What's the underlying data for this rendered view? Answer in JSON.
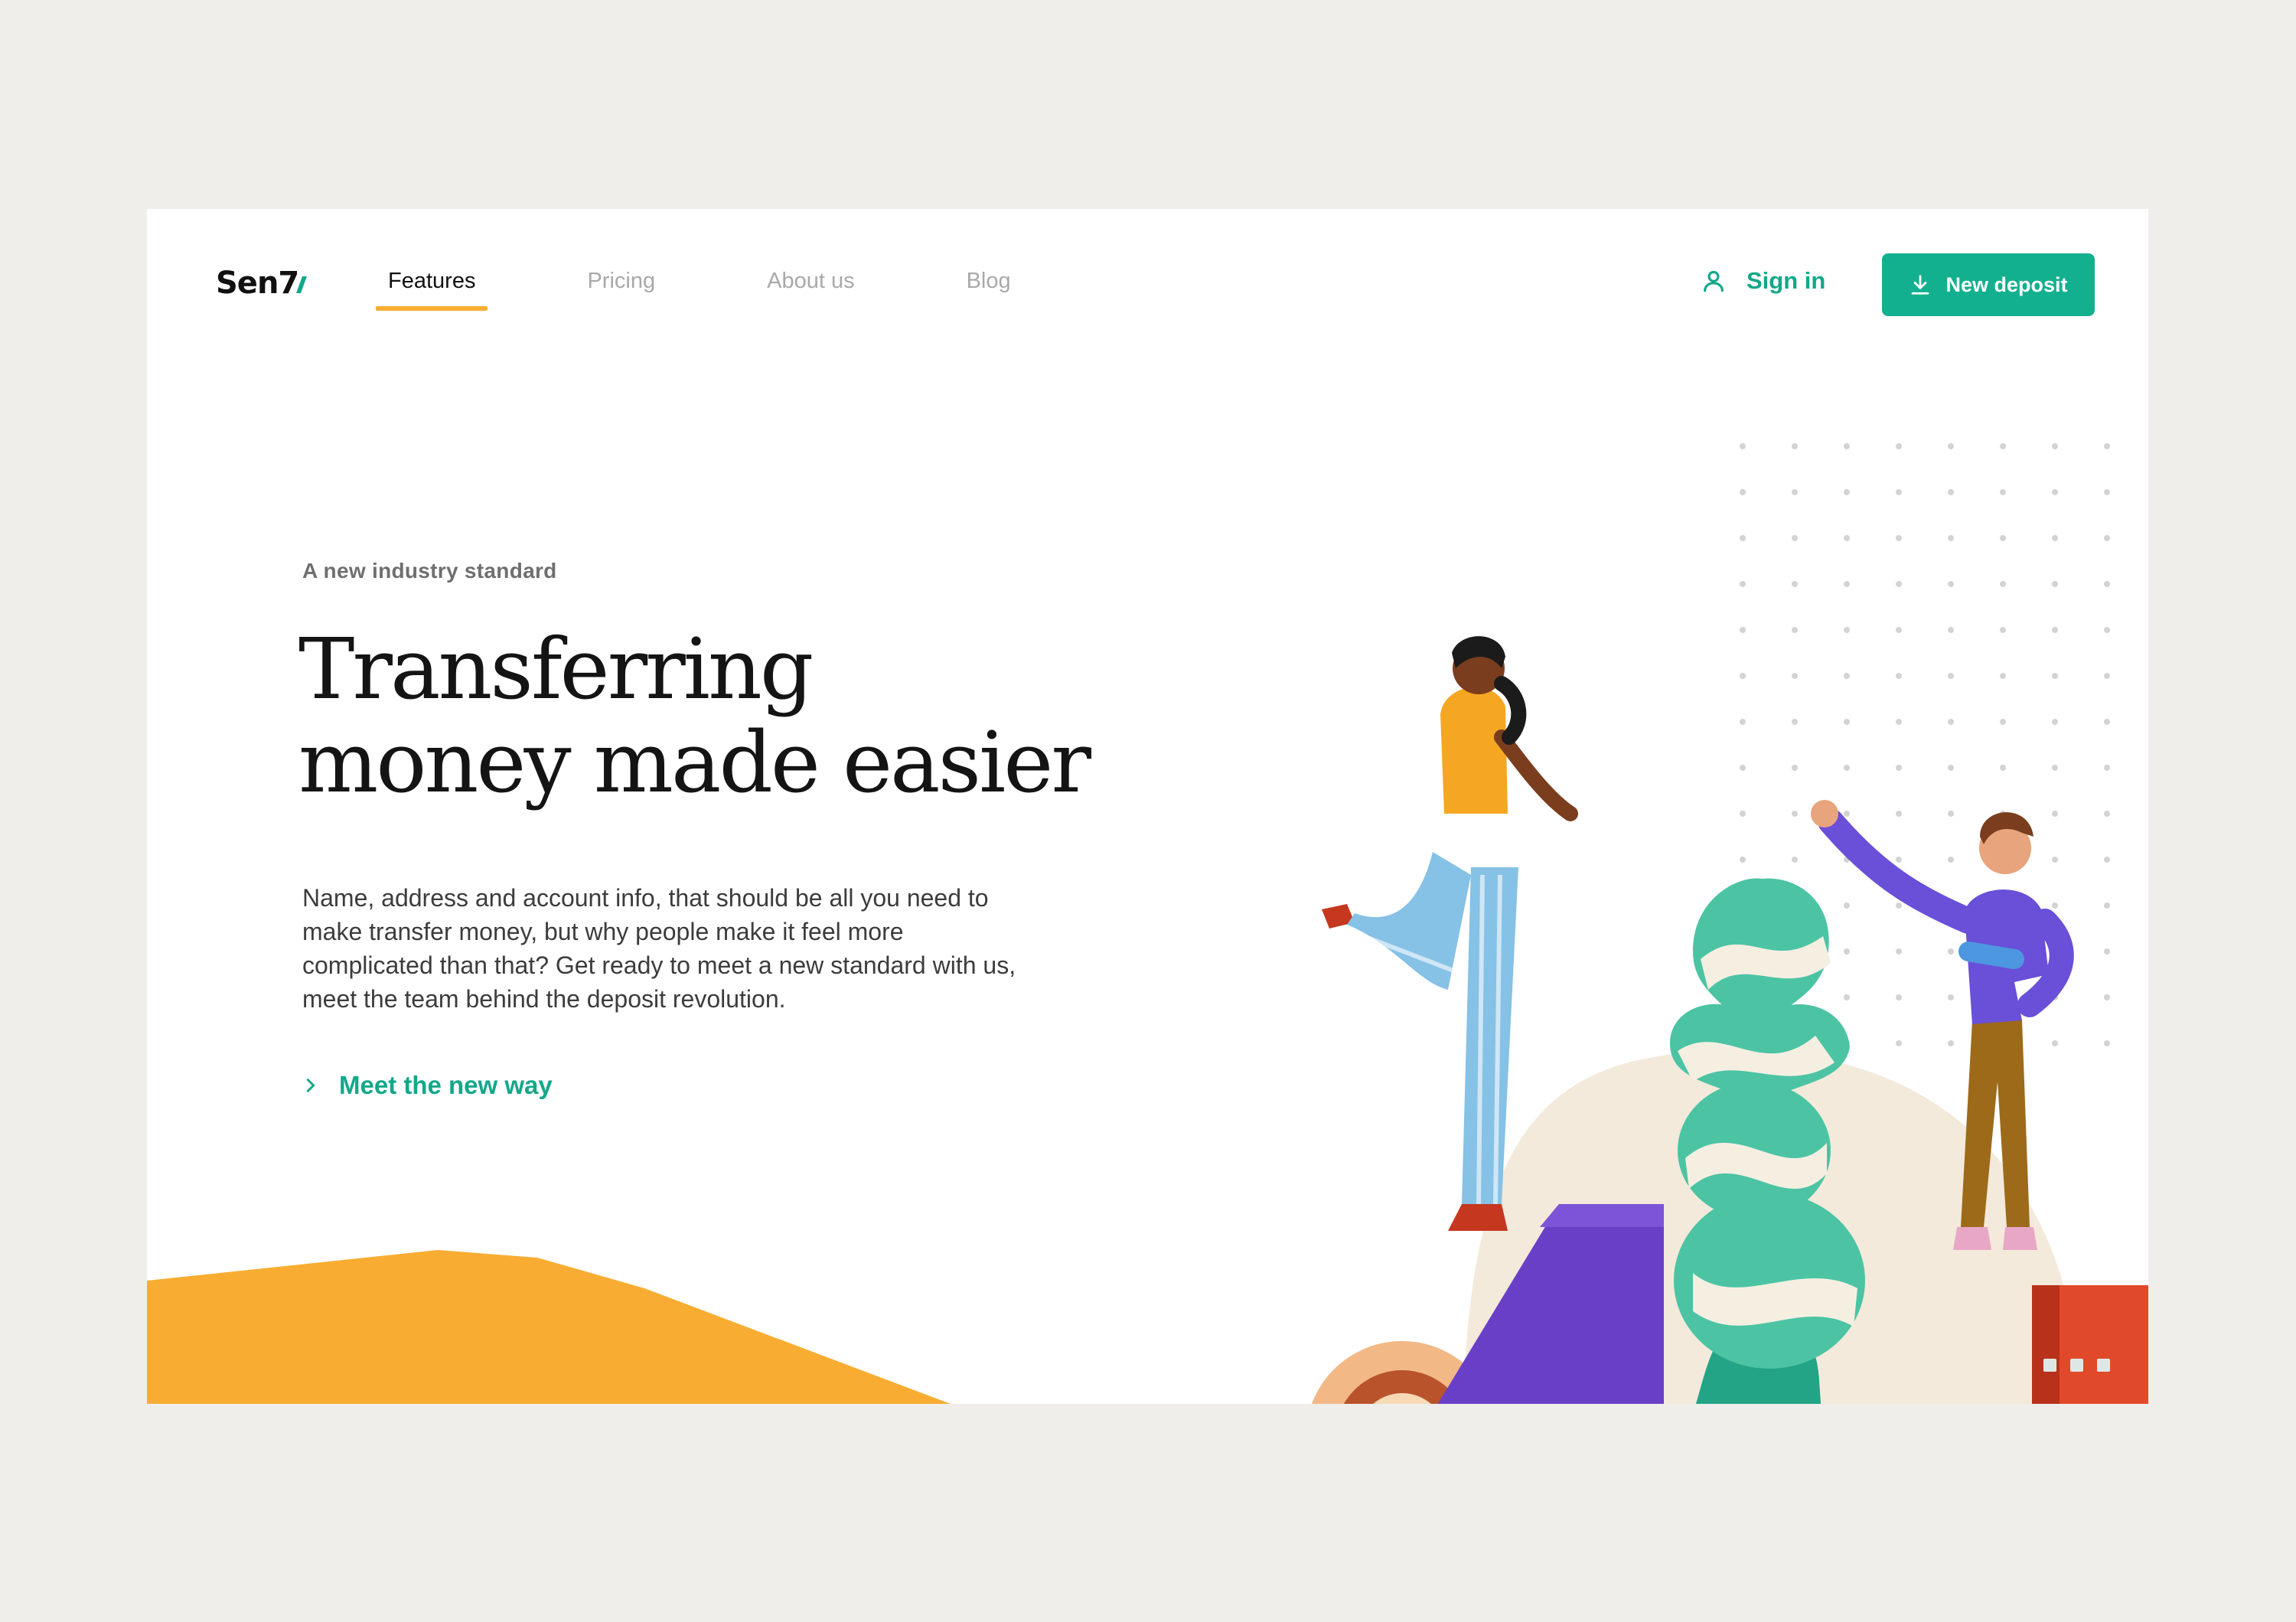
{
  "brand": {
    "logo_text": "Sen7",
    "accent_color": "#12a88a"
  },
  "nav": {
    "items": [
      {
        "label": "Features",
        "active": true
      },
      {
        "label": "Pricing",
        "active": false
      },
      {
        "label": "About us",
        "active": false
      },
      {
        "label": "Blog",
        "active": false
      }
    ],
    "active_indicator_color": "#f8ad32"
  },
  "header": {
    "sign_in_label": "Sign in",
    "sign_in_icon": "user-icon",
    "deposit_button_label": "New deposit",
    "deposit_icon": "download-icon",
    "primary_color": "#13b08f"
  },
  "hero": {
    "eyebrow": "A new industry standard",
    "headline_line1": "Transferring",
    "headline_line2": "money made easier",
    "description": "Name, address and account info, that should be all you need to make transfer money, but why people make it feel more complicated than that? Get ready to meet a new standard with us, meet the team behind the deposit revolution.",
    "cta_label": "Meet the new way",
    "cta_icon": "chevron-right-icon"
  },
  "pager": {
    "count": 3
  },
  "colors": {
    "background": "#efeeea",
    "card": "#ffffff",
    "orange": "#f8ad32",
    "purple": "#6a3fc8",
    "red": "#e04a2a",
    "teal": "#4cc4a4"
  }
}
